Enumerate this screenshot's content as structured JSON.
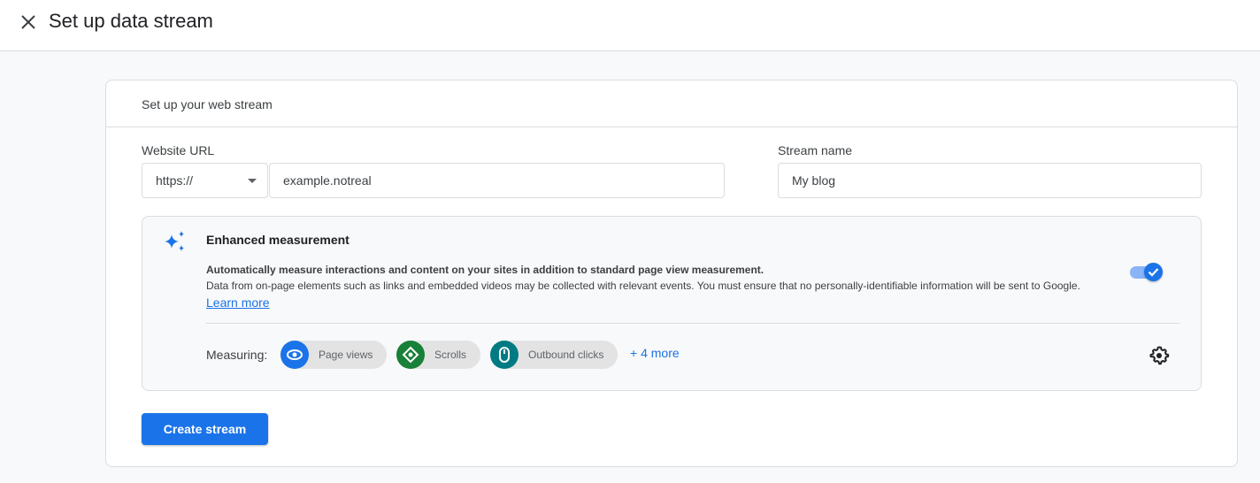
{
  "header": {
    "title": "Set up data stream"
  },
  "card": {
    "heading": "Set up your web stream",
    "website_url_label": "Website URL",
    "protocol": "https://",
    "url_value": "example.notreal",
    "stream_name_label": "Stream name",
    "stream_name_value": "My blog"
  },
  "enhanced": {
    "title": "Enhanced measurement",
    "description": "Automatically measure interactions and content on your sites in addition to standard page view measurement.",
    "notice": "Data from on-page elements such as links and embedded videos may be collected with relevant events. You must ensure that no personally-identifiable information will be sent to Google.",
    "learn_more": "Learn more",
    "enabled": true,
    "measuring_label": "Measuring:",
    "chips": [
      {
        "label": "Page views",
        "icon": "eye-icon",
        "color": "#1a73e8"
      },
      {
        "label": "Scrolls",
        "icon": "scroll-icon",
        "color": "#188038"
      },
      {
        "label": "Outbound clicks",
        "icon": "mouse-icon",
        "color": "#007b83"
      }
    ],
    "more": "+ 4 more"
  },
  "actions": {
    "create": "Create stream"
  }
}
